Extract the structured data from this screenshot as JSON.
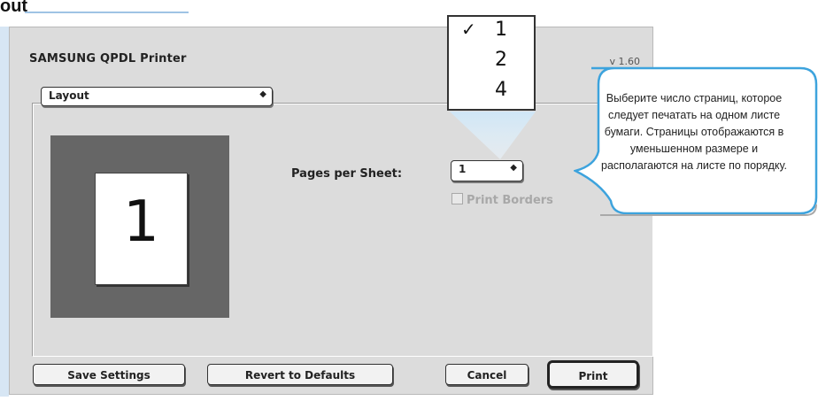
{
  "doc": {
    "heading_fragment": "out"
  },
  "dialog": {
    "title": "SAMSUNG QPDL Printer",
    "version": "v 1.60",
    "panel_popup": {
      "selected": "Layout"
    },
    "preview": {
      "page_number": "1"
    },
    "pages_per_sheet": {
      "label": "Pages per Sheet:",
      "selected": "1"
    },
    "print_borders": {
      "label": "Print Borders",
      "checked": false,
      "enabled": false
    },
    "buttons": {
      "save": "Save Settings",
      "revert": "Revert to Defaults",
      "cancel": "Cancel",
      "print": "Print"
    }
  },
  "menu": {
    "items": [
      {
        "value": "1",
        "check": "✓"
      },
      {
        "value": "2",
        "check": ""
      },
      {
        "value": "4",
        "check": ""
      }
    ]
  },
  "callout": {
    "text": "Выберите число страниц, которое следует печатать на одном листе бумаги. Страницы отображаются в уменьшенном размере и располагаются на листе по порядку."
  },
  "colors": {
    "dialog_bg": "#dcdcdc",
    "preview_bg": "#666666",
    "callout_border": "#3da3dd"
  }
}
